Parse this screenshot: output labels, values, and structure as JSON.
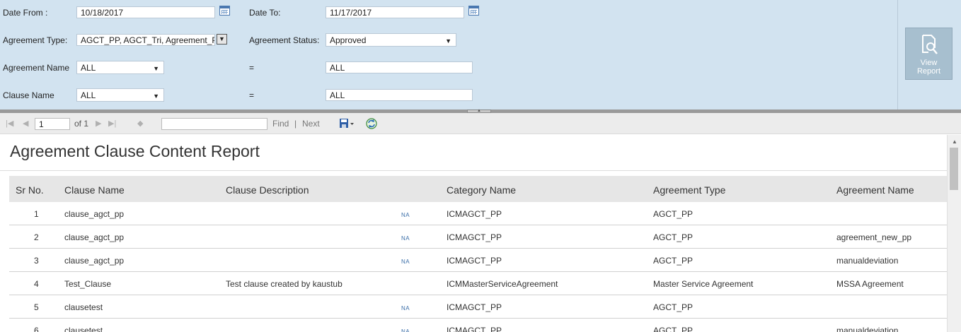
{
  "params": {
    "date_from_label": "Date From :",
    "date_from_value": "10/18/2017",
    "date_to_label": "Date To:",
    "date_to_value": "11/17/2017",
    "agreement_type_label": "Agreement Type:",
    "agreement_type_value": "AGCT_PP, AGCT_Tri, Agreement_Pro",
    "agreement_status_label": "Agreement Status:",
    "agreement_status_value": "Approved",
    "agreement_name_label": "Agreement Name",
    "agreement_name_value": "ALL",
    "agreement_name_eq": "=",
    "agreement_name_text": "ALL",
    "clause_name_label": "Clause Name",
    "clause_name_value": "ALL",
    "clause_name_eq": "=",
    "clause_name_text": "ALL",
    "view_report_line1": "View",
    "view_report_line2": "Report"
  },
  "toolbar": {
    "page_value": "1",
    "of_label": "of 1",
    "find_label": "Find",
    "separator": "|",
    "next_label": "Next"
  },
  "report": {
    "title": "Agreement Clause Content Report",
    "columns": [
      "Sr No.",
      "Clause Name",
      "Clause Description",
      "Category Name",
      "Agreement Type",
      "Agreement Name"
    ],
    "rows": [
      {
        "sr": "1",
        "clause": "clause_agct_pp",
        "desc": "",
        "na": "NA",
        "category": "ICMAGCT_PP",
        "type": "AGCT_PP",
        "name": ""
      },
      {
        "sr": "2",
        "clause": "clause_agct_pp",
        "desc": "",
        "na": "NA",
        "category": "ICMAGCT_PP",
        "type": "AGCT_PP",
        "name": "agreement_new_pp"
      },
      {
        "sr": "3",
        "clause": "clause_agct_pp",
        "desc": "",
        "na": "NA",
        "category": "ICMAGCT_PP",
        "type": "AGCT_PP",
        "name": "manualdeviation"
      },
      {
        "sr": "4",
        "clause": "Test_Clause",
        "desc": "Test clause created by kaustub",
        "na": "",
        "category": "ICMMasterServiceAgreement",
        "type": "Master Service Agreement",
        "name": "MSSA Agreement"
      },
      {
        "sr": "5",
        "clause": "clausetest",
        "desc": "",
        "na": "NA",
        "category": "ICMAGCT_PP",
        "type": "AGCT_PP",
        "name": ""
      },
      {
        "sr": "6",
        "clause": "clausetest",
        "desc": "",
        "na": "NA",
        "category": "ICMAGCT_PP",
        "type": "AGCT_PP",
        "name": "manualdeviation"
      }
    ]
  }
}
